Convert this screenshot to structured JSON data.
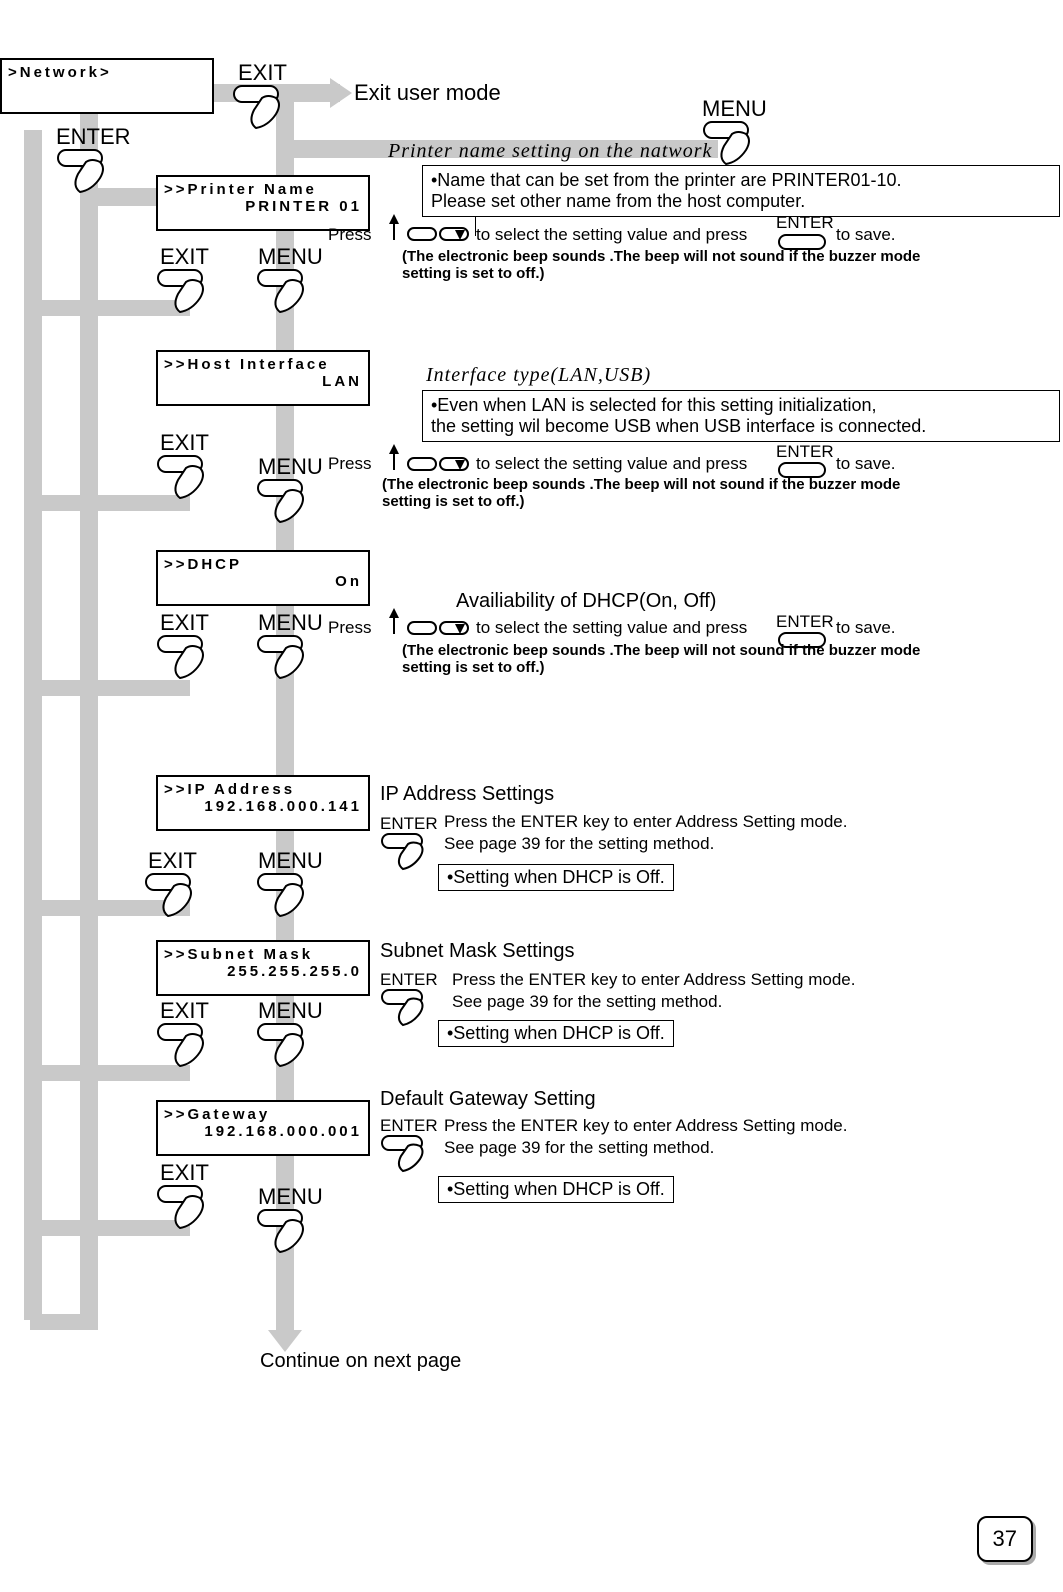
{
  "page_number": "37",
  "top": {
    "network_label": ">Network>",
    "exit": "EXIT",
    "exit_user_mode": "Exit user mode",
    "enter": "ENTER",
    "menu_top_right": "MENU"
  },
  "common": {
    "exit": "EXIT",
    "menu": "MENU",
    "enter": "ENTER",
    "press_prefix": "Press",
    "to_select_and_press": " to select the setting value and press ",
    "to_save": " to save.",
    "beep_note": "(The electronic beep sounds .The beep will not sound if the buzzer mode setting is set to off.)",
    "enter_to_address": "Press the ENTER key to enter Address Setting mode.",
    "see_page": "See page 39 for the setting method.",
    "dhcp_off_note": "•Setting when DHCP is Off.",
    "continue": "Continue on next page"
  },
  "printer_name": {
    "heading": "Printer name setting on the natwork",
    "lcd_l1": ">>Printer Name",
    "lcd_l2": "PRINTER 01",
    "note": "•Name that can be set from the printer are PRINTER01-10.\n  Please set other name from the host computer."
  },
  "host_if": {
    "heading": "Interface type(LAN,USB)",
    "lcd_l1": ">>Host Interface",
    "lcd_l2": "LAN",
    "note": "•Even when LAN is selected for this setting initialization,\n  the setting wil become USB when USB interface is connected."
  },
  "dhcp": {
    "heading": "Availiability of DHCP(On, Off)",
    "lcd_l1": ">>DHCP",
    "lcd_l2": "On"
  },
  "ip": {
    "heading": "IP Address Settings",
    "lcd_l1": ">>IP Address",
    "lcd_l2": "192.168.000.141"
  },
  "subnet": {
    "heading": "Subnet Mask Settings",
    "lcd_l1": ">>Subnet Mask",
    "lcd_l2": "255.255.255.0"
  },
  "gateway": {
    "heading": "Default Gateway Setting",
    "lcd_l1": ">>Gateway",
    "lcd_l2": "192.168.000.001"
  }
}
